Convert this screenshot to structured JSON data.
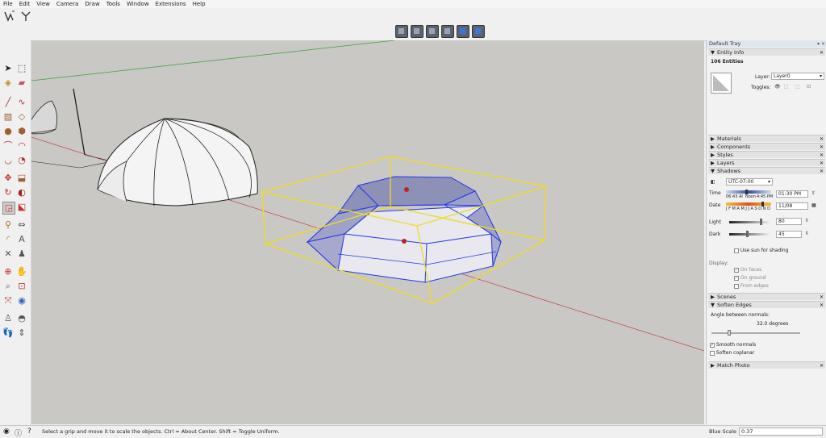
{
  "menu": [
    "File",
    "Edit",
    "View",
    "Camera",
    "Draw",
    "Tools",
    "Window",
    "Extensions",
    "Help"
  ],
  "tray": {
    "title": "Default Tray",
    "entity_info": {
      "header": "Entity Info",
      "count": "106 Entities",
      "layer_label": "Layer:",
      "layer_value": "Layer0",
      "toggles_label": "Toggles:"
    },
    "collapsed_panels": [
      "Materials",
      "Components",
      "Styles",
      "Layers"
    ],
    "shadows": {
      "header": "Shadows",
      "timezone": "UTC-07:00",
      "time_label": "Time",
      "time_start": "06:43 AI",
      "time_noon": "Noon",
      "time_end": "4:45 PM",
      "time_value": "01:30 PM",
      "date_label": "Date",
      "months": "J F M A M J J A S O N D",
      "date_value": "11/08",
      "light_label": "Light",
      "light_value": "80",
      "light_level": 0.8,
      "dark_label": "Dark",
      "dark_value": "45",
      "dark_level": 0.45,
      "use_sun": "Use sun for shading",
      "display_label": "Display:",
      "on_faces": "On faces",
      "on_ground": "On ground",
      "from_edges": "From edges"
    },
    "scenes": "Scenes",
    "soften_edges": {
      "header": "Soften Edges",
      "angle_label": "Angle between normals:",
      "angle_value": "32.0  degrees",
      "smooth_normals": "Smooth normals",
      "soften_coplanar": "Soften coplanar"
    },
    "match_photo": "Match Photo"
  },
  "status": {
    "message": "Select a grip and move it to scale the objects. Ctrl = About Center. Shift = Toggle Uniform.",
    "scale_label": "Blue Scale",
    "scale_value": "0.37"
  },
  "colors": {
    "viewport_bg": "#c9c8c4",
    "selection_box": "#f2dc1e",
    "selected_edges": "#2438e6",
    "green_axis": "#3aa03a",
    "red_axis": "#c03030"
  }
}
